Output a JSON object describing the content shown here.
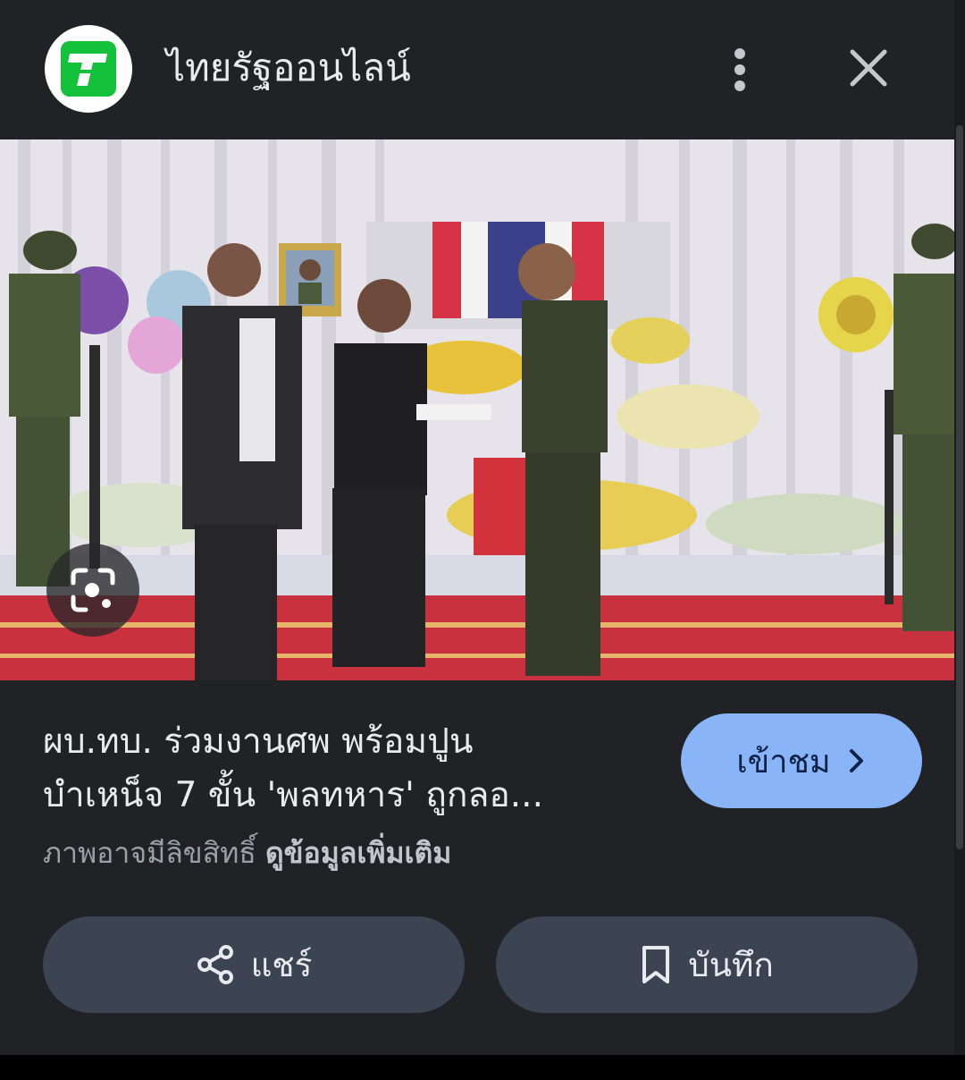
{
  "header": {
    "site_name": "ไทยรัฐออนไลน์",
    "logo_icon": "thairath-logo-icon",
    "brand_color": "#13c23a"
  },
  "image": {
    "subject": "photo"
  },
  "caption": {
    "headline_line1": "ผบ.ทบ. ร่วมงานศพ พร้อมปูน",
    "headline_line2": "บำเหน็จ 7 ขั้น 'พลทหาร' ถูกลอ...",
    "visit_label": "เข้าชม",
    "rights_text": "ภาพอาจมีลิขสิทธิ์",
    "more_info_label": "ดูข้อมูลเพิ่มเติม"
  },
  "actions": {
    "share_label": "แชร์",
    "save_label": "บันทึก"
  },
  "colors": {
    "panel": "#202226",
    "accent": "#8ab4f8",
    "action_button": "#3c4454"
  }
}
